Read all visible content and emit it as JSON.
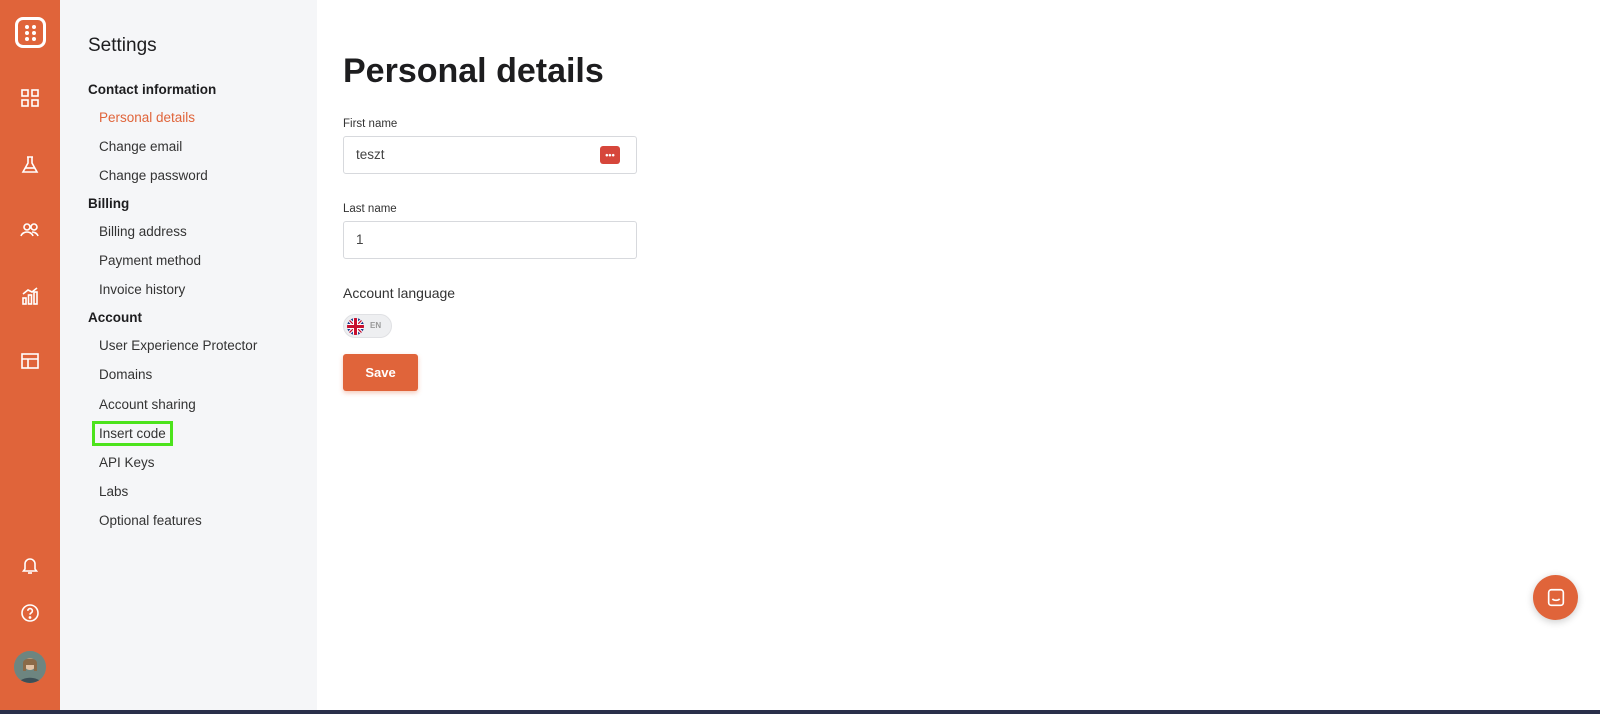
{
  "rail": {
    "icons": [
      "logo-icon",
      "dashboard-icon",
      "flask-icon",
      "users-icon",
      "analytics-icon",
      "layout-icon",
      "bell-icon",
      "help-icon"
    ]
  },
  "sidebar": {
    "title": "Settings",
    "sections": [
      {
        "heading": "Contact information",
        "items": [
          "Personal details",
          "Change email",
          "Change password"
        ]
      },
      {
        "heading": "Billing",
        "items": [
          "Billing address",
          "Payment method",
          "Invoice history"
        ]
      },
      {
        "heading": "Account",
        "items": [
          "User Experience Protector",
          "Domains",
          "Account sharing",
          "Insert code",
          "API Keys",
          "Labs",
          "Optional features"
        ]
      }
    ],
    "active_item": "Personal details",
    "highlighted_item": "Insert code"
  },
  "main": {
    "title": "Personal details",
    "first_name": {
      "label": "First name",
      "value": "teszt",
      "badge": "•••"
    },
    "last_name": {
      "label": "Last name",
      "value": "1"
    },
    "language": {
      "label": "Account language",
      "code": "EN"
    },
    "save_label": "Save"
  },
  "colors": {
    "accent": "#e0643a",
    "highlight": "#4ce31c",
    "sidebar_bg": "#f5f6f8"
  }
}
